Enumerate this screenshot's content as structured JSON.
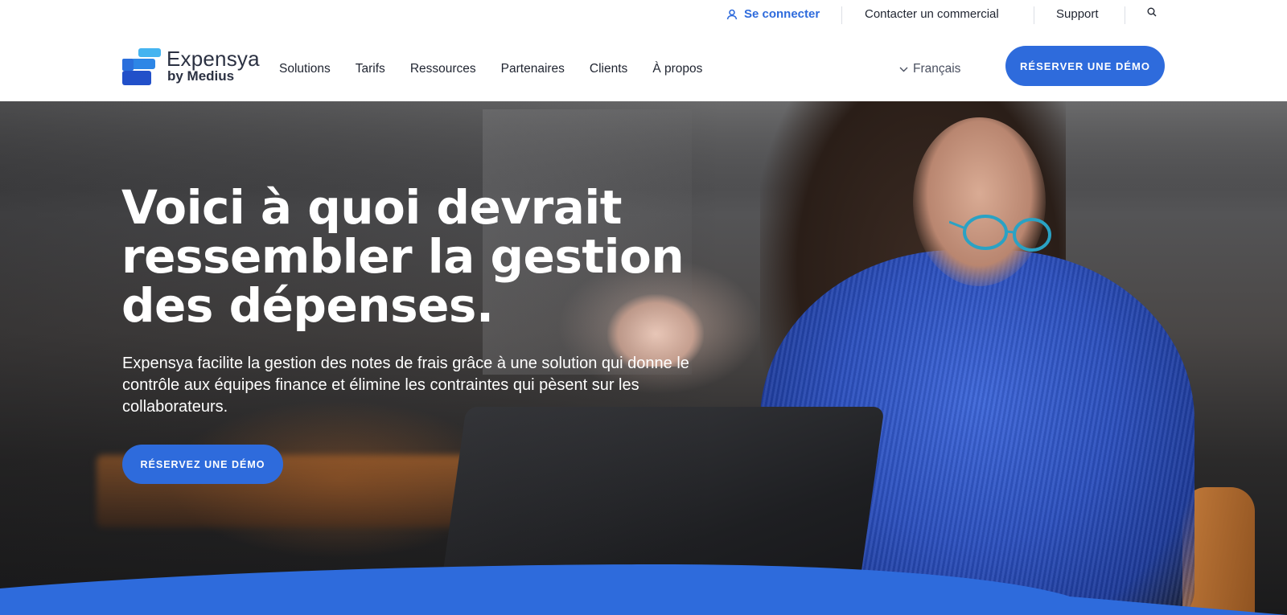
{
  "topbar": {
    "login_label": "Se connecter",
    "contact_label": "Contacter un commercial",
    "support_label": "Support"
  },
  "nav": {
    "brand_name": "Expensya",
    "brand_sub": "by Medius",
    "menu": [
      "Solutions",
      "Tarifs",
      "Ressources",
      "Partenaires",
      "Clients",
      "À propos"
    ],
    "language": "Français",
    "cta_label": "RÉSERVER UNE DÉMO"
  },
  "hero": {
    "title": "Voici à quoi devrait ressembler la gestion des dépenses.",
    "lead": "Expensya facilite la gestion des notes de frais grâce à une solution qui donne le contrôle aux équipes finance et élimine les contraintes qui pèsent sur les collaborateurs.",
    "cta_label": "RÉSERVEZ UNE DÉMO"
  },
  "icons": {
    "login": "user-icon",
    "search": "search-icon",
    "language": "chevron-down-icon"
  },
  "colors": {
    "accent": "#2e6bdc",
    "text_dark": "#1f2430",
    "white": "#ffffff"
  }
}
